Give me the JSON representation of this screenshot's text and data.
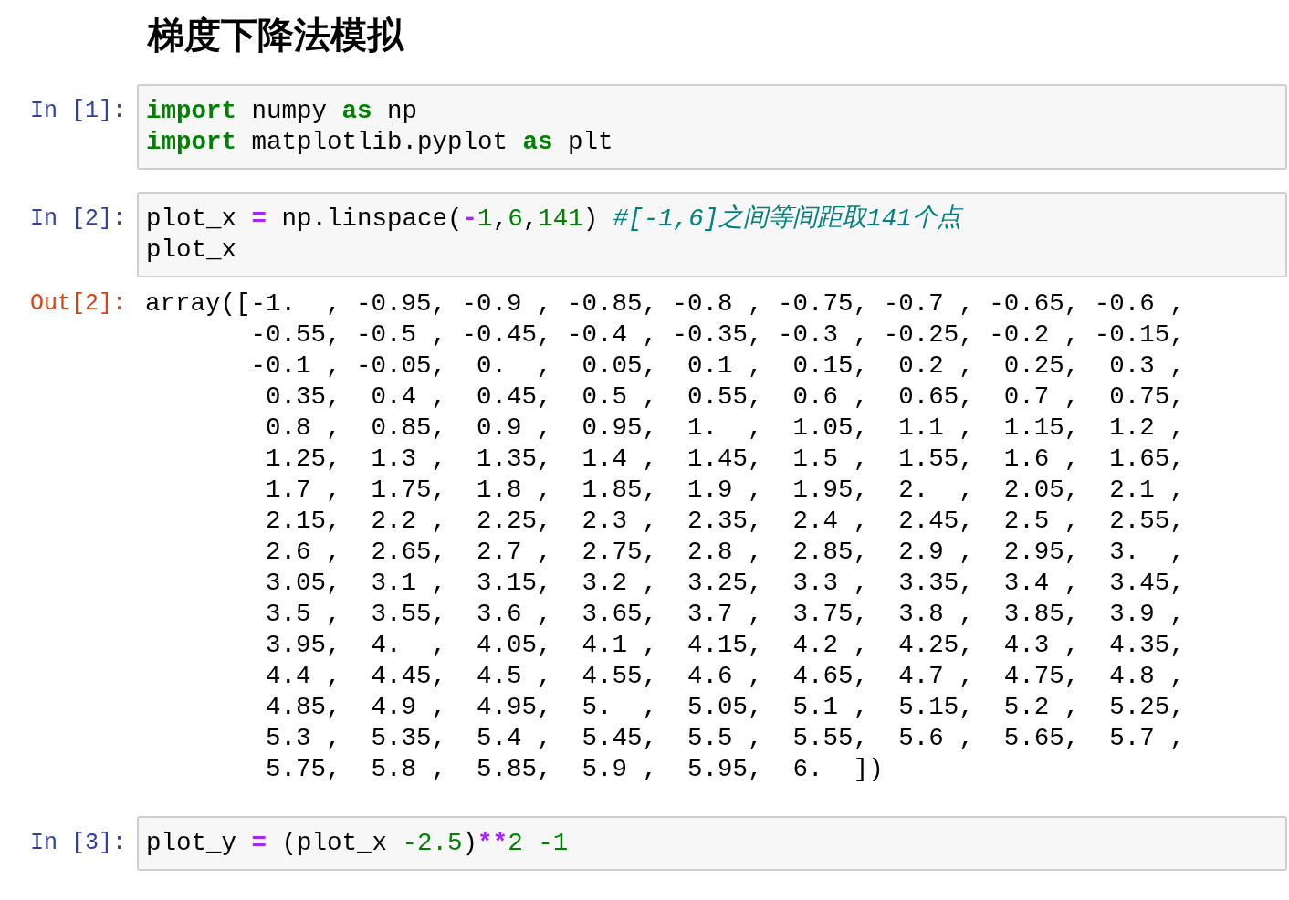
{
  "heading": "梯度下降法模拟",
  "cells": [
    {
      "kind": "input",
      "prompt": "In [1]:",
      "lines": [
        [
          {
            "kind": "keyword",
            "text": "import"
          },
          {
            "kind": "plain",
            "text": " numpy "
          },
          {
            "kind": "keyword",
            "text": "as"
          },
          {
            "kind": "plain",
            "text": " np"
          }
        ],
        [
          {
            "kind": "keyword",
            "text": "import"
          },
          {
            "kind": "plain",
            "text": " matplotlib.pyplot "
          },
          {
            "kind": "keyword",
            "text": "as"
          },
          {
            "kind": "plain",
            "text": " plt"
          }
        ]
      ]
    },
    {
      "kind": "input",
      "prompt": "In [2]:",
      "lines": [
        [
          {
            "kind": "plain",
            "text": "plot_x "
          },
          {
            "kind": "operator",
            "text": "="
          },
          {
            "kind": "plain",
            "text": " np.linspace("
          },
          {
            "kind": "operator",
            "text": "-"
          },
          {
            "kind": "number",
            "text": "1"
          },
          {
            "kind": "plain",
            "text": ","
          },
          {
            "kind": "number",
            "text": "6"
          },
          {
            "kind": "plain",
            "text": ","
          },
          {
            "kind": "number",
            "text": "141"
          },
          {
            "kind": "plain",
            "text": ") "
          },
          {
            "kind": "comment",
            "text": "#[-1,6]之间等间距取141个点"
          }
        ],
        [
          {
            "kind": "plain",
            "text": "plot_x"
          }
        ]
      ]
    },
    {
      "kind": "output",
      "prompt": "Out[2]:",
      "text_lines": [
        "array([-1.  , -0.95, -0.9 , -0.85, -0.8 , -0.75, -0.7 , -0.65, -0.6 ,",
        "       -0.55, -0.5 , -0.45, -0.4 , -0.35, -0.3 , -0.25, -0.2 , -0.15,",
        "       -0.1 , -0.05,  0.  ,  0.05,  0.1 ,  0.15,  0.2 ,  0.25,  0.3 ,",
        "        0.35,  0.4 ,  0.45,  0.5 ,  0.55,  0.6 ,  0.65,  0.7 ,  0.75,",
        "        0.8 ,  0.85,  0.9 ,  0.95,  1.  ,  1.05,  1.1 ,  1.15,  1.2 ,",
        "        1.25,  1.3 ,  1.35,  1.4 ,  1.45,  1.5 ,  1.55,  1.6 ,  1.65,",
        "        1.7 ,  1.75,  1.8 ,  1.85,  1.9 ,  1.95,  2.  ,  2.05,  2.1 ,",
        "        2.15,  2.2 ,  2.25,  2.3 ,  2.35,  2.4 ,  2.45,  2.5 ,  2.55,",
        "        2.6 ,  2.65,  2.7 ,  2.75,  2.8 ,  2.85,  2.9 ,  2.95,  3.  ,",
        "        3.05,  3.1 ,  3.15,  3.2 ,  3.25,  3.3 ,  3.35,  3.4 ,  3.45,",
        "        3.5 ,  3.55,  3.6 ,  3.65,  3.7 ,  3.75,  3.8 ,  3.85,  3.9 ,",
        "        3.95,  4.  ,  4.05,  4.1 ,  4.15,  4.2 ,  4.25,  4.3 ,  4.35,",
        "        4.4 ,  4.45,  4.5 ,  4.55,  4.6 ,  4.65,  4.7 ,  4.75,  4.8 ,",
        "        4.85,  4.9 ,  4.95,  5.  ,  5.05,  5.1 ,  5.15,  5.2 ,  5.25,",
        "        5.3 ,  5.35,  5.4 ,  5.45,  5.5 ,  5.55,  5.6 ,  5.65,  5.7 ,",
        "        5.75,  5.8 ,  5.85,  5.9 ,  5.95,  6.  ])"
      ]
    },
    {
      "kind": "input",
      "prompt": "In [3]:",
      "lines": [
        [
          {
            "kind": "plain",
            "text": "plot_y "
          },
          {
            "kind": "operator",
            "text": "="
          },
          {
            "kind": "plain",
            "text": " (plot_x "
          },
          {
            "kind": "number",
            "text": "-2.5"
          },
          {
            "kind": "plain",
            "text": ")"
          },
          {
            "kind": "operator",
            "text": "**"
          },
          {
            "kind": "number",
            "text": "2"
          },
          {
            "kind": "number",
            "text": " -1"
          }
        ]
      ]
    }
  ]
}
